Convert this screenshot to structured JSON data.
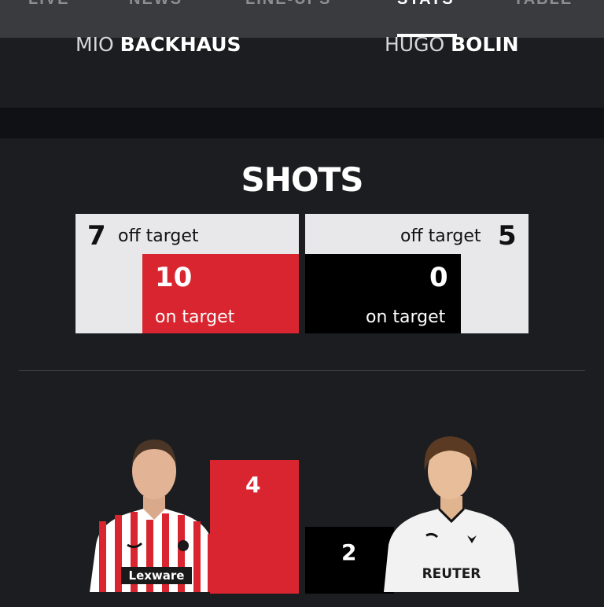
{
  "tabs": [
    {
      "label": "LIVE",
      "active": false
    },
    {
      "label": "NEWS",
      "active": false
    },
    {
      "label": "LINE-UPS",
      "active": false
    },
    {
      "label": "STATS",
      "active": true
    },
    {
      "label": "TABLE",
      "active": false
    }
  ],
  "players": {
    "left": {
      "first": "MIO",
      "last": "BACKHAUS"
    },
    "right": {
      "first": "HUGO",
      "last": "BOLIN"
    }
  },
  "shots": {
    "title": "SHOTS",
    "home": {
      "off_target": "7",
      "off_label": "off target",
      "on_target": "10",
      "on_label": "on target",
      "color": "#d9252f"
    },
    "away": {
      "off_target": "5",
      "off_label": "off target",
      "on_target": "0",
      "on_label": "on target",
      "color": "#000000"
    }
  },
  "player_compare": {
    "home_value": "4",
    "away_value": "2",
    "home_color": "#d9252f",
    "away_color": "#000000",
    "home_sponsor": "Lexware",
    "away_sponsor": "REUTER"
  }
}
